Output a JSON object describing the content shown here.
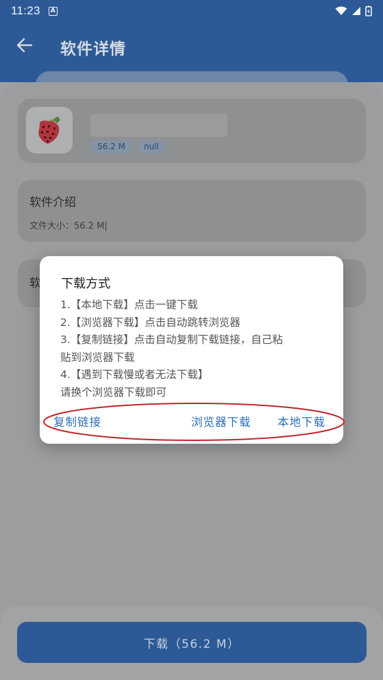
{
  "status_bar": {
    "time": "11:23",
    "notification_icon": "A"
  },
  "header": {
    "title": "软件详情"
  },
  "app": {
    "size_tag": "56.2 M",
    "version_tag": "null"
  },
  "intro": {
    "title": "软件介绍",
    "file_size": "文件大小：56.2 M|"
  },
  "third_card": {
    "label": "软"
  },
  "dialog": {
    "title": "下载方式",
    "lines": [
      "1.【本地下载】点击一键下载",
      "2.【浏览器下载】点击自动跳转浏览器",
      "3.【复制链接】点击自动复制下载链接，自己粘",
      "贴到浏览器下载",
      "4.【遇到下载慢或者无法下载】",
      "请换个浏览器下载即可"
    ],
    "actions": {
      "copy": "复制链接",
      "browser": "浏览器下载",
      "local": "本地下载"
    }
  },
  "download_button": {
    "label": "下载（56.2 M）"
  },
  "colors": {
    "primary": "#2d5a97",
    "action_text": "#2f6fb7",
    "annotation": "#c0252a"
  }
}
